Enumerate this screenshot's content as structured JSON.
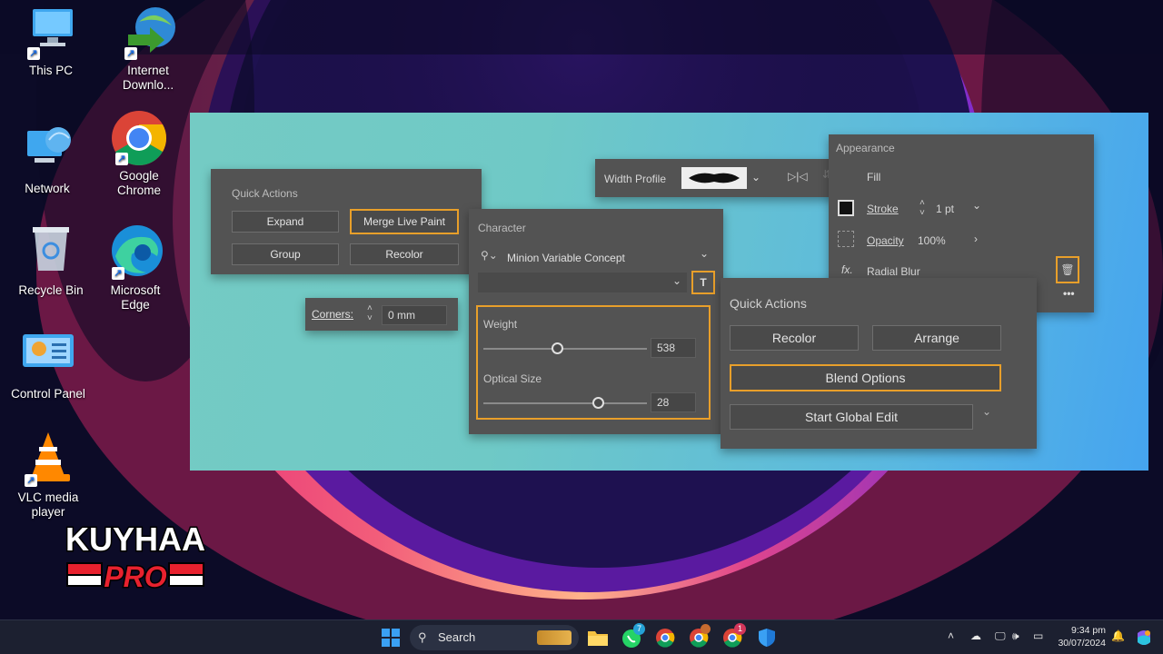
{
  "desktop": {
    "icons": [
      {
        "label1": "This PC",
        "label2": ""
      },
      {
        "label1": "Internet",
        "label2": "Downlo..."
      },
      {
        "label1": "Network",
        "label2": ""
      },
      {
        "label1": "Google",
        "label2": "Chrome"
      },
      {
        "label1": "Recycle Bin",
        "label2": ""
      },
      {
        "label1": "Microsoft",
        "label2": "Edge"
      },
      {
        "label1": "Control Panel",
        "label2": ""
      },
      {
        "label1": "VLC media",
        "label2": "player"
      }
    ]
  },
  "quick_actions_left": {
    "title": "Quick Actions",
    "expand": "Expand",
    "merge": "Merge Live Paint",
    "group": "Group",
    "recolor": "Recolor"
  },
  "corners": {
    "label": "Corners:",
    "value": "0 mm"
  },
  "width_profile": {
    "label": "Width Profile"
  },
  "character": {
    "title": "Character",
    "font": "Minion Variable Concept",
    "weight_label": "Weight",
    "weight_value": "538",
    "weight_fraction": 0.45,
    "optical_label": "Optical Size",
    "optical_value": "28",
    "optical_fraction": 0.7
  },
  "appearance": {
    "title": "Appearance",
    "fill": "Fill",
    "stroke": "Stroke",
    "stroke_value": "1 pt",
    "opacity": "Opacity",
    "opacity_value": "100%",
    "fx": "fx.",
    "effect": "Radial Blur"
  },
  "quick_actions_right": {
    "title": "Quick Actions",
    "recolor": "Recolor",
    "arrange": "Arrange",
    "blend": "Blend Options",
    "global_edit": "Start Global Edit"
  },
  "taskbar": {
    "search_placeholder": "Search",
    "whatsapp_badge": "7",
    "chrome2_badge": "1",
    "time": "9:34 pm",
    "date": "30/07/2024"
  },
  "watermark": {
    "line1": "KUYHAA",
    "line2": "PRO"
  },
  "colors": {
    "accent_highlight": "#e89f2a",
    "panel": "#535353",
    "taskbar": "#1c2030"
  }
}
